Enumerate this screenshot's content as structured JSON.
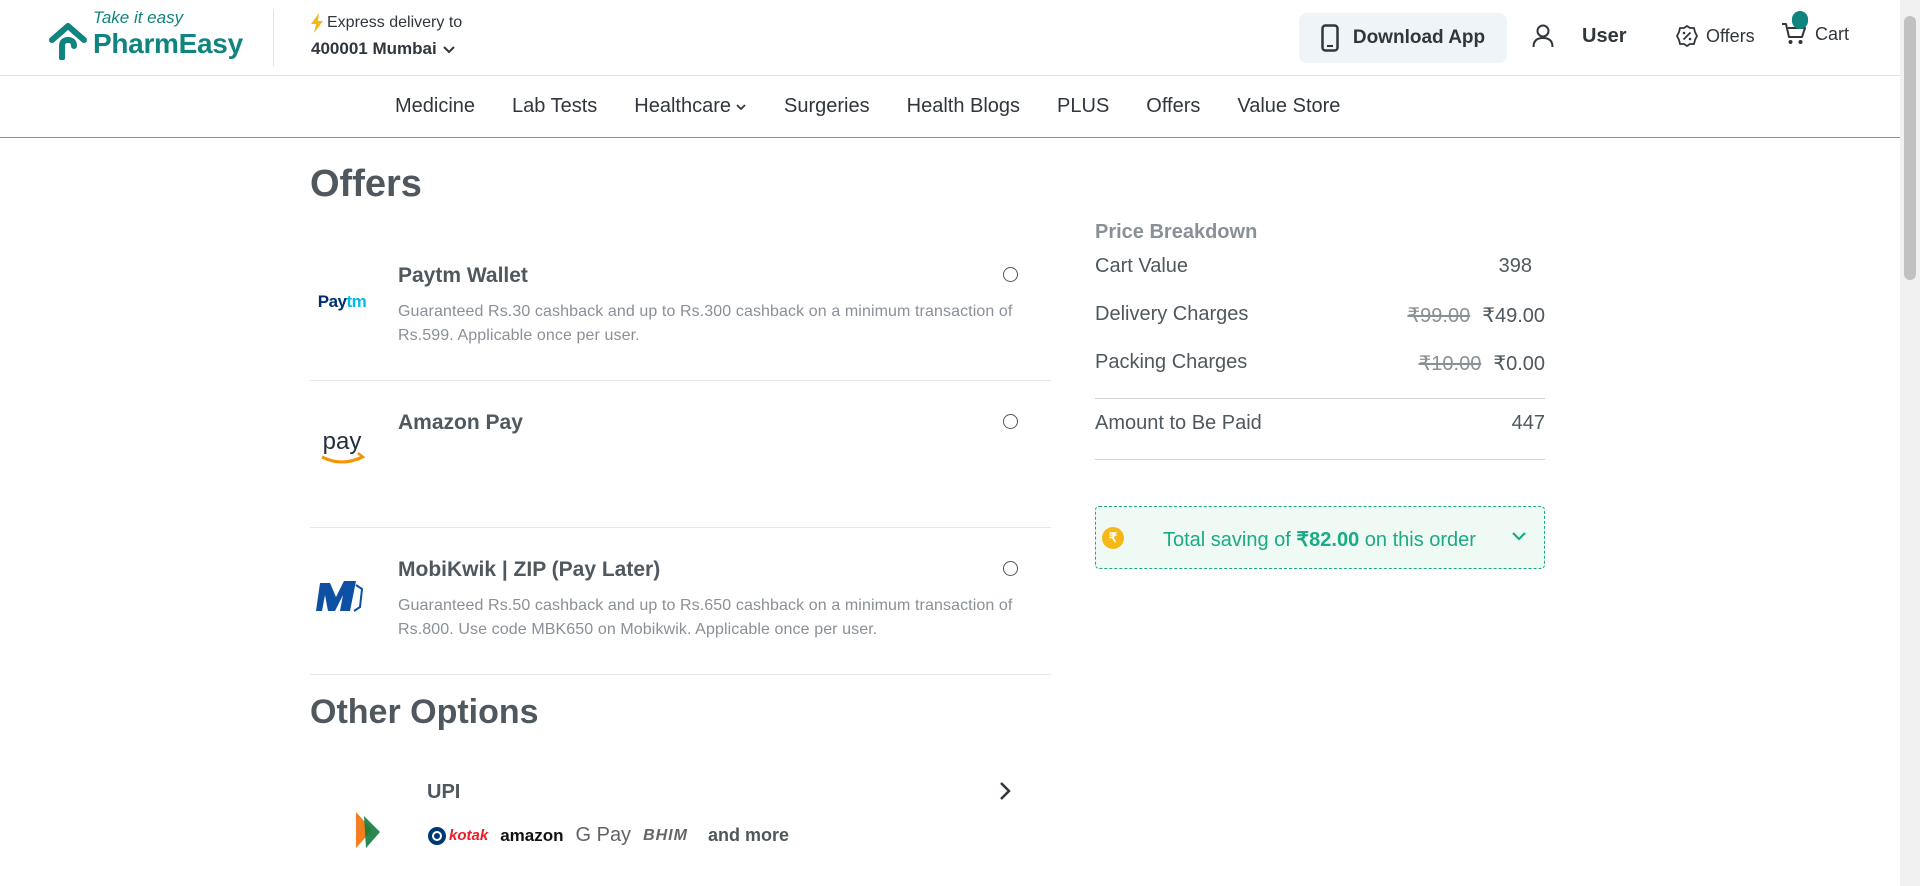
{
  "header": {
    "logo_tagline": "Take it easy",
    "logo_brand": "PharmEasy",
    "delivery_label": "Express delivery to",
    "delivery_location": "400001 Mumbai",
    "download_app": "Download App",
    "user_label": "User",
    "offers_label": "Offers",
    "cart_label": "Cart",
    "brand_color": "#10847e"
  },
  "nav": {
    "items": [
      "Medicine",
      "Lab Tests",
      "Healthcare",
      "Surgeries",
      "Health Blogs",
      "PLUS",
      "Offers",
      "Value Store"
    ]
  },
  "main": {
    "title": "Offers",
    "offers": [
      {
        "name": "Paytm Wallet",
        "logo_text": "Paytm",
        "description": "Guaranteed Rs.30 cashback and up to Rs.300 cashback on a minimum transaction of Rs.599. Applicable once per user."
      },
      {
        "name": "Amazon Pay",
        "logo_text": "pay",
        "description": ""
      },
      {
        "name": "MobiKwik | ZIP (Pay Later)",
        "logo_text": "M",
        "description": "Guaranteed Rs.50 cashback and up to Rs.650 cashback on a minimum transaction of Rs.800. Use code MBK650 on Mobikwik. Applicable once per user."
      }
    ],
    "other_title": "Other Options",
    "upi": {
      "name": "UPI",
      "apps": [
        "kotak",
        "amazon",
        "G Pay",
        "BHIM"
      ],
      "more": "and more"
    }
  },
  "price": {
    "title": "Price Breakdown",
    "cart_value_label": "Cart Value",
    "cart_value": "398",
    "delivery_label": "Delivery Charges",
    "delivery_old": "₹99.00",
    "delivery_new": "₹49.00",
    "packing_label": "Packing Charges",
    "packing_old": "₹10.00",
    "packing_new": "₹0.00",
    "total_label": "Amount to Be Paid",
    "total": "447",
    "saving_prefix": "Total saving of",
    "saving_amount": "₹82.00",
    "saving_suffix": "on this order",
    "coin_symbol": "₹"
  }
}
